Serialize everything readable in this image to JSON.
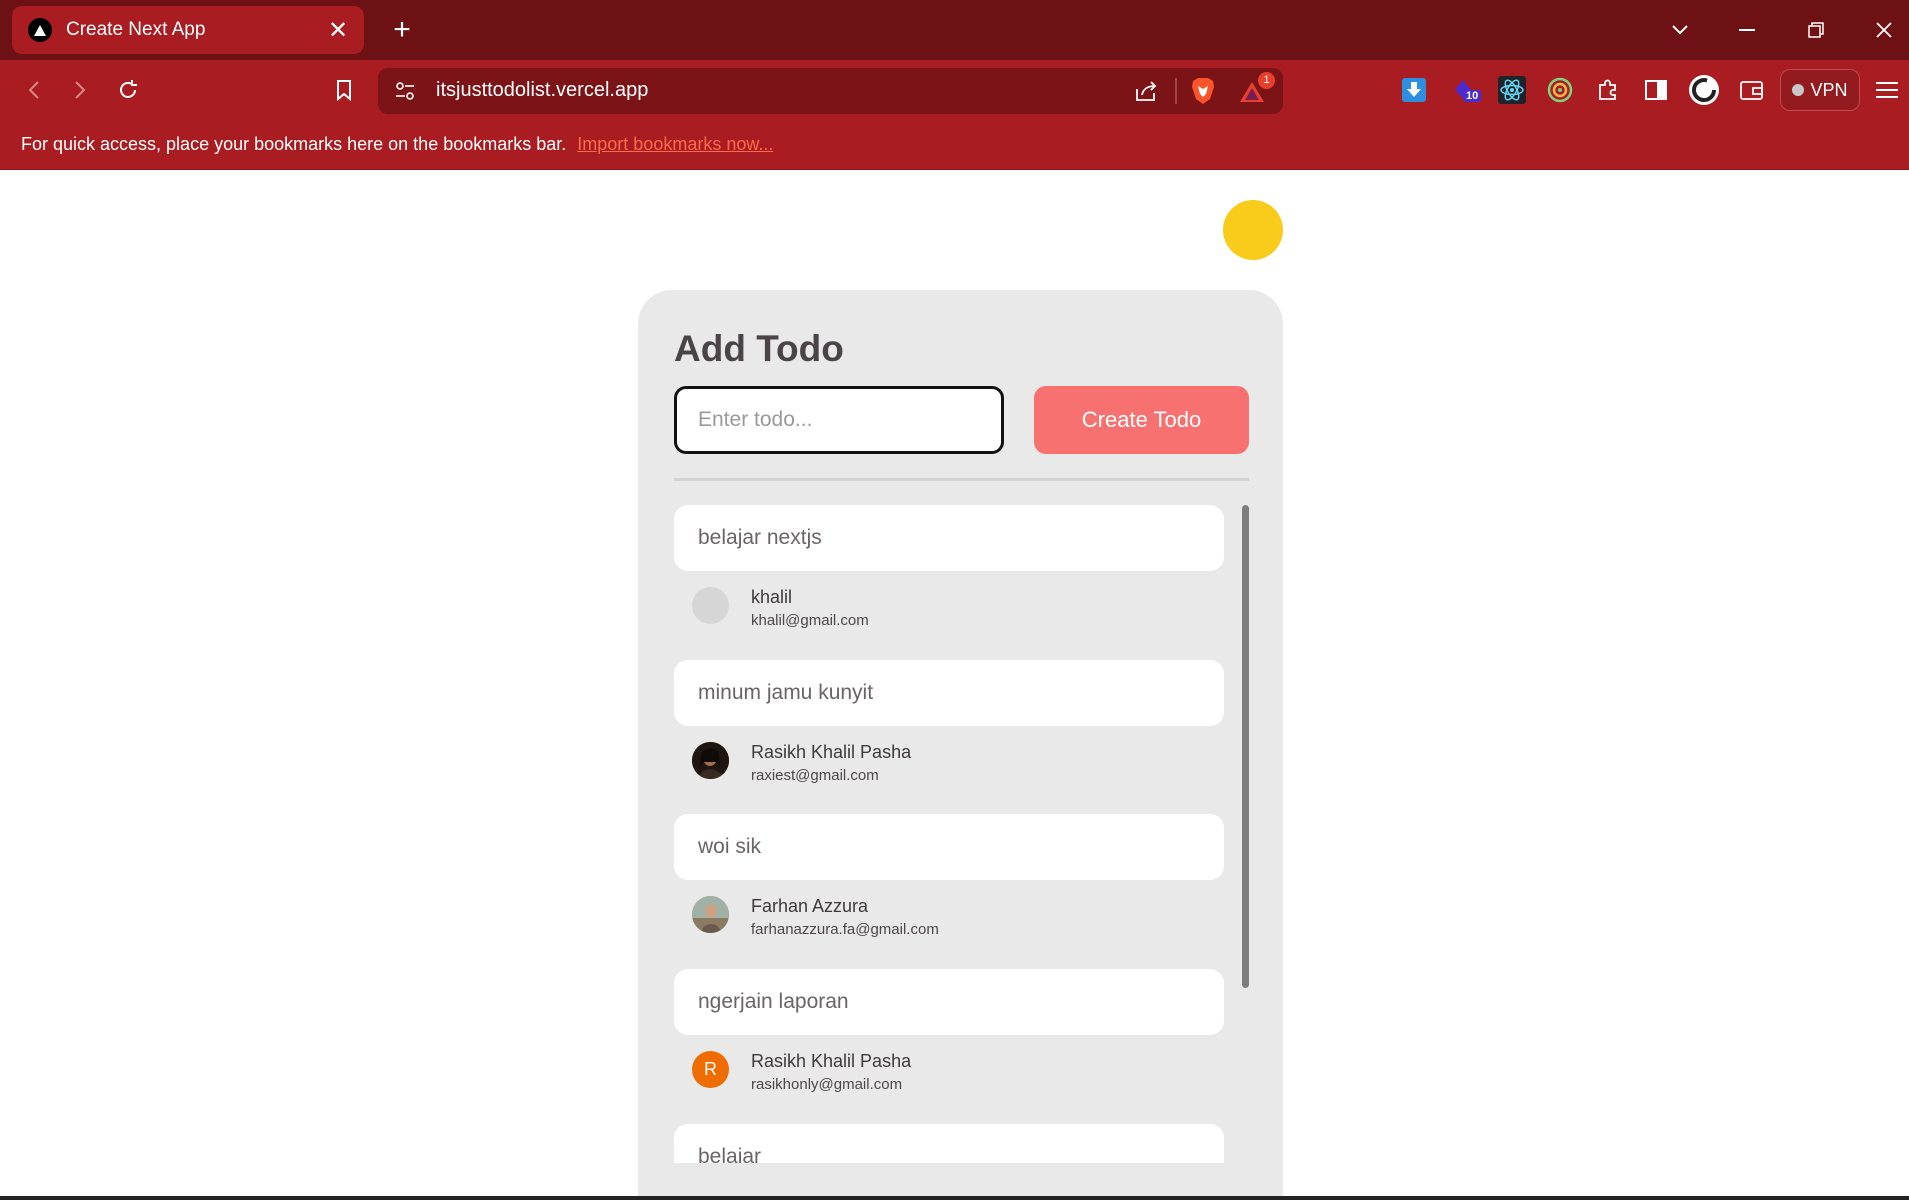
{
  "browser": {
    "tab_title": "Create Next App",
    "tab_close": "✕",
    "new_tab": "+",
    "url": "itsjusttodolist.vercel.app",
    "vpn_label": "VPN",
    "ext_badge_count": "10",
    "brave_alert_count": "1",
    "bookmarks_message": "For quick access, place your bookmarks here on the bookmarks bar.",
    "bookmarks_link": "Import bookmarks now..."
  },
  "colors": {
    "chrome_dark": "#6e1115",
    "chrome": "#a91d22",
    "accent_button": "#f87171",
    "theme_toggle": "#f9cb1a",
    "card_bg": "#e9e9e9"
  },
  "app": {
    "title": "Add Todo",
    "input_placeholder": "Enter todo...",
    "input_value": "",
    "create_button": "Create Todo",
    "todos": [
      {
        "text": "belajar nextjs",
        "user_name": "khalil",
        "user_email": "khalil@gmail.com",
        "avatar": "blank"
      },
      {
        "text": "minum jamu kunyit",
        "user_name": "Rasikh Khalil Pasha",
        "user_email": "raxiest@gmail.com",
        "avatar": "photo-dark"
      },
      {
        "text": "woi sik",
        "user_name": "Farhan Azzura",
        "user_email": "farhanazzura.fa@gmail.com",
        "avatar": "photo-outdoor"
      },
      {
        "text": "ngerjain laporan",
        "user_name": "Rasikh Khalil Pasha",
        "user_email": "rasikhonly@gmail.com",
        "avatar": "letter",
        "avatar_letter": "R"
      },
      {
        "text": "belajar"
      }
    ]
  }
}
